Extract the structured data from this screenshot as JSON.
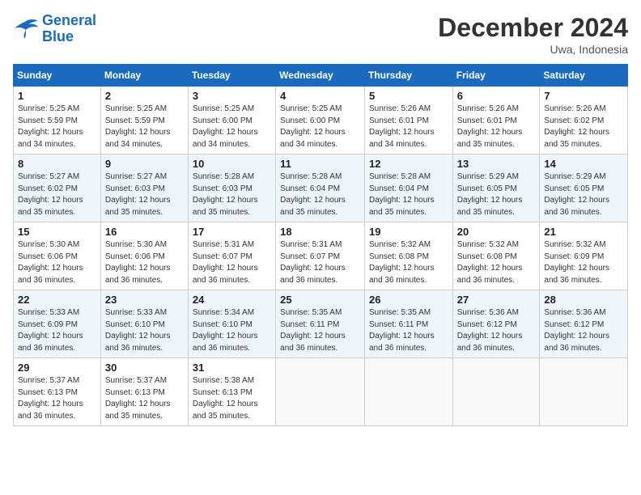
{
  "logo": {
    "general": "General",
    "blue": "Blue"
  },
  "header": {
    "title": "December 2024",
    "location": "Uwa, Indonesia"
  },
  "weekdays": [
    "Sunday",
    "Monday",
    "Tuesday",
    "Wednesday",
    "Thursday",
    "Friday",
    "Saturday"
  ],
  "weeks": [
    [
      {
        "day": "1",
        "info": "Sunrise: 5:25 AM\nSunset: 5:59 PM\nDaylight: 12 hours\nand 34 minutes."
      },
      {
        "day": "2",
        "info": "Sunrise: 5:25 AM\nSunset: 5:59 PM\nDaylight: 12 hours\nand 34 minutes."
      },
      {
        "day": "3",
        "info": "Sunrise: 5:25 AM\nSunset: 6:00 PM\nDaylight: 12 hours\nand 34 minutes."
      },
      {
        "day": "4",
        "info": "Sunrise: 5:25 AM\nSunset: 6:00 PM\nDaylight: 12 hours\nand 34 minutes."
      },
      {
        "day": "5",
        "info": "Sunrise: 5:26 AM\nSunset: 6:01 PM\nDaylight: 12 hours\nand 34 minutes."
      },
      {
        "day": "6",
        "info": "Sunrise: 5:26 AM\nSunset: 6:01 PM\nDaylight: 12 hours\nand 35 minutes."
      },
      {
        "day": "7",
        "info": "Sunrise: 5:26 AM\nSunset: 6:02 PM\nDaylight: 12 hours\nand 35 minutes."
      }
    ],
    [
      {
        "day": "8",
        "info": "Sunrise: 5:27 AM\nSunset: 6:02 PM\nDaylight: 12 hours\nand 35 minutes."
      },
      {
        "day": "9",
        "info": "Sunrise: 5:27 AM\nSunset: 6:03 PM\nDaylight: 12 hours\nand 35 minutes."
      },
      {
        "day": "10",
        "info": "Sunrise: 5:28 AM\nSunset: 6:03 PM\nDaylight: 12 hours\nand 35 minutes."
      },
      {
        "day": "11",
        "info": "Sunrise: 5:28 AM\nSunset: 6:04 PM\nDaylight: 12 hours\nand 35 minutes."
      },
      {
        "day": "12",
        "info": "Sunrise: 5:28 AM\nSunset: 6:04 PM\nDaylight: 12 hours\nand 35 minutes."
      },
      {
        "day": "13",
        "info": "Sunrise: 5:29 AM\nSunset: 6:05 PM\nDaylight: 12 hours\nand 35 minutes."
      },
      {
        "day": "14",
        "info": "Sunrise: 5:29 AM\nSunset: 6:05 PM\nDaylight: 12 hours\nand 36 minutes."
      }
    ],
    [
      {
        "day": "15",
        "info": "Sunrise: 5:30 AM\nSunset: 6:06 PM\nDaylight: 12 hours\nand 36 minutes."
      },
      {
        "day": "16",
        "info": "Sunrise: 5:30 AM\nSunset: 6:06 PM\nDaylight: 12 hours\nand 36 minutes."
      },
      {
        "day": "17",
        "info": "Sunrise: 5:31 AM\nSunset: 6:07 PM\nDaylight: 12 hours\nand 36 minutes."
      },
      {
        "day": "18",
        "info": "Sunrise: 5:31 AM\nSunset: 6:07 PM\nDaylight: 12 hours\nand 36 minutes."
      },
      {
        "day": "19",
        "info": "Sunrise: 5:32 AM\nSunset: 6:08 PM\nDaylight: 12 hours\nand 36 minutes."
      },
      {
        "day": "20",
        "info": "Sunrise: 5:32 AM\nSunset: 6:08 PM\nDaylight: 12 hours\nand 36 minutes."
      },
      {
        "day": "21",
        "info": "Sunrise: 5:32 AM\nSunset: 6:09 PM\nDaylight: 12 hours\nand 36 minutes."
      }
    ],
    [
      {
        "day": "22",
        "info": "Sunrise: 5:33 AM\nSunset: 6:09 PM\nDaylight: 12 hours\nand 36 minutes."
      },
      {
        "day": "23",
        "info": "Sunrise: 5:33 AM\nSunset: 6:10 PM\nDaylight: 12 hours\nand 36 minutes."
      },
      {
        "day": "24",
        "info": "Sunrise: 5:34 AM\nSunset: 6:10 PM\nDaylight: 12 hours\nand 36 minutes."
      },
      {
        "day": "25",
        "info": "Sunrise: 5:35 AM\nSunset: 6:11 PM\nDaylight: 12 hours\nand 36 minutes."
      },
      {
        "day": "26",
        "info": "Sunrise: 5:35 AM\nSunset: 6:11 PM\nDaylight: 12 hours\nand 36 minutes."
      },
      {
        "day": "27",
        "info": "Sunrise: 5:36 AM\nSunset: 6:12 PM\nDaylight: 12 hours\nand 36 minutes."
      },
      {
        "day": "28",
        "info": "Sunrise: 5:36 AM\nSunset: 6:12 PM\nDaylight: 12 hours\nand 36 minutes."
      }
    ],
    [
      {
        "day": "29",
        "info": "Sunrise: 5:37 AM\nSunset: 6:13 PM\nDaylight: 12 hours\nand 36 minutes."
      },
      {
        "day": "30",
        "info": "Sunrise: 5:37 AM\nSunset: 6:13 PM\nDaylight: 12 hours\nand 35 minutes."
      },
      {
        "day": "31",
        "info": "Sunrise: 5:38 AM\nSunset: 6:13 PM\nDaylight: 12 hours\nand 35 minutes."
      },
      null,
      null,
      null,
      null
    ]
  ]
}
